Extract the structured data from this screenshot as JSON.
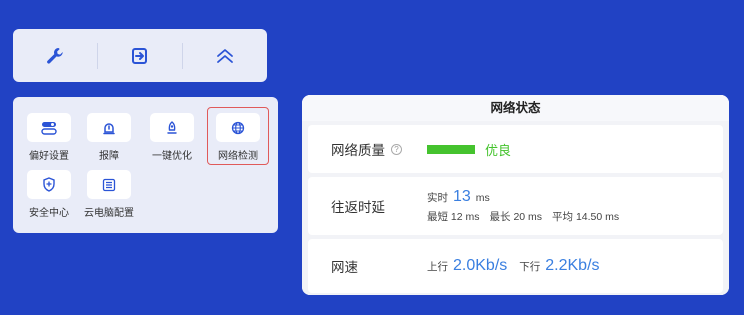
{
  "toolbar": {
    "icons": [
      "wrench-icon",
      "exit-icon",
      "chevron-up-icon"
    ]
  },
  "menu": {
    "items": [
      {
        "label": "偏好设置",
        "icon": "toggle-icon"
      },
      {
        "label": "报障",
        "icon": "alert-icon"
      },
      {
        "label": "一键优化",
        "icon": "rocket-icon"
      },
      {
        "label": "网络检测",
        "icon": "globe-icon",
        "active": true
      },
      {
        "label": "安全中心",
        "icon": "shield-icon"
      },
      {
        "label": "云电脑配置",
        "icon": "settings-list-icon"
      }
    ]
  },
  "network": {
    "title": "网络状态",
    "quality": {
      "label": "网络质量",
      "help": "?",
      "value": "优良",
      "color": "#45c32e"
    },
    "latency": {
      "label": "往返时延",
      "realtime_label": "实时",
      "realtime_value": "13",
      "realtime_unit": "ms",
      "min_label": "最短",
      "min_value": "12 ms",
      "max_label": "最长",
      "max_value": "20 ms",
      "avg_label": "平均",
      "avg_value": "14.50 ms"
    },
    "speed": {
      "label": "网速",
      "up_label": "上行",
      "up_value": "2.0Kb/s",
      "down_label": "下行",
      "down_value": "2.2Kb/s"
    }
  },
  "colors": {
    "background": "#2142c4",
    "accent": "#3a7fe0",
    "highlight": "#e05a5a"
  }
}
